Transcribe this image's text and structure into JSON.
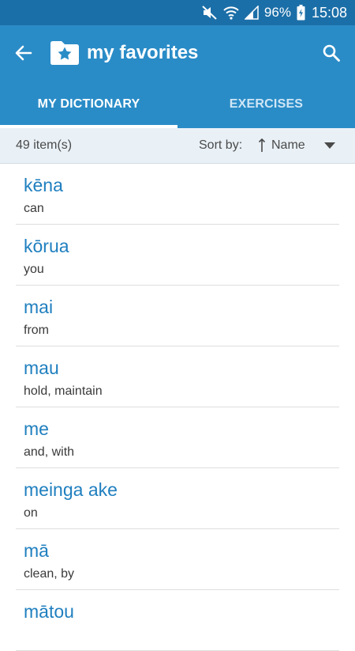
{
  "status_bar": {
    "battery_percent": "96%",
    "time": "15:08",
    "icons": [
      "mute-icon",
      "wifi-icon",
      "signal-icon",
      "battery-charging-icon"
    ]
  },
  "app_bar": {
    "title": "my favorites",
    "back_icon": "arrow-left-icon",
    "logo_icon": "folder-star-icon",
    "search_icon": "search-icon"
  },
  "tabs": [
    {
      "label": "MY DICTIONARY",
      "active": true
    },
    {
      "label": "EXERCISES",
      "active": false
    }
  ],
  "sort_bar": {
    "count": "49 item(s)",
    "sort_label": "Sort by:",
    "sort_value": "Name",
    "sort_icon": "sort-ascending-icon",
    "dropdown_icon": "dropdown-arrow-icon"
  },
  "list": [
    {
      "word": "kēna",
      "meaning": "can"
    },
    {
      "word": "kōrua",
      "meaning": "you"
    },
    {
      "word": "mai",
      "meaning": "from"
    },
    {
      "word": "mau",
      "meaning": "hold, maintain"
    },
    {
      "word": "me",
      "meaning": "and, with"
    },
    {
      "word": "meinga ake",
      "meaning": "on"
    },
    {
      "word": "mā",
      "meaning": "clean, by"
    },
    {
      "word": "mātou",
      "meaning": ""
    }
  ],
  "colors": {
    "status_bar": "#1b6fa8",
    "app_bar": "#2a8cc7",
    "word_text": "#1f7fbf",
    "sort_bar_bg": "#e9f1f7"
  }
}
